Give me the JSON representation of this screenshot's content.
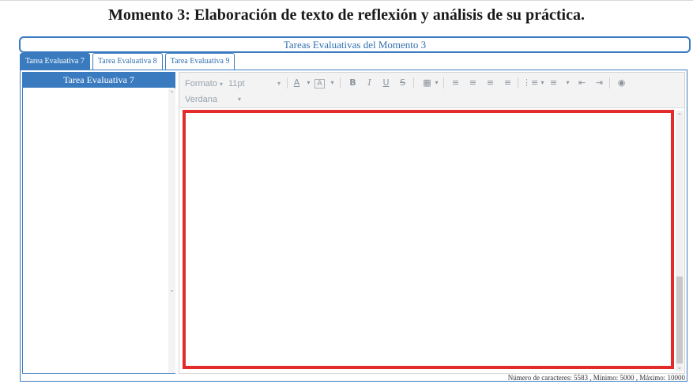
{
  "page": {
    "title": "Momento 3: Elaboración de texto de reflexión y análisis de su práctica.",
    "section_title": "Tareas Evaluativas del Momento 3"
  },
  "tabs": [
    {
      "label": "Tarea Evaluativa 7",
      "active": true
    },
    {
      "label": "Tarea Evaluativa 8",
      "active": false
    },
    {
      "label": "Tarea Evaluativa 9",
      "active": false
    }
  ],
  "list": {
    "header": "Tarea Evaluativa 7"
  },
  "toolbar": {
    "format_label": "Formato",
    "size_label": "11pt",
    "font_label": "Verdana",
    "icons": [
      "font-color-icon",
      "highlight-icon",
      "bold-icon",
      "italic-icon",
      "underline-icon",
      "strikethrough-icon",
      "table-icon",
      "align-left-icon",
      "align-center-icon",
      "align-right-icon",
      "justify-icon",
      "bullet-list-icon",
      "numbered-list-icon",
      "outdent-icon",
      "indent-icon",
      "preview-icon"
    ]
  },
  "footer": {
    "counter_text": "Número de caracteres: 5583 , Mínimo: 5000 , Máximo: 10000"
  },
  "colors": {
    "accent": "#3a7bbf",
    "highlight_border": "#e32b2b"
  }
}
